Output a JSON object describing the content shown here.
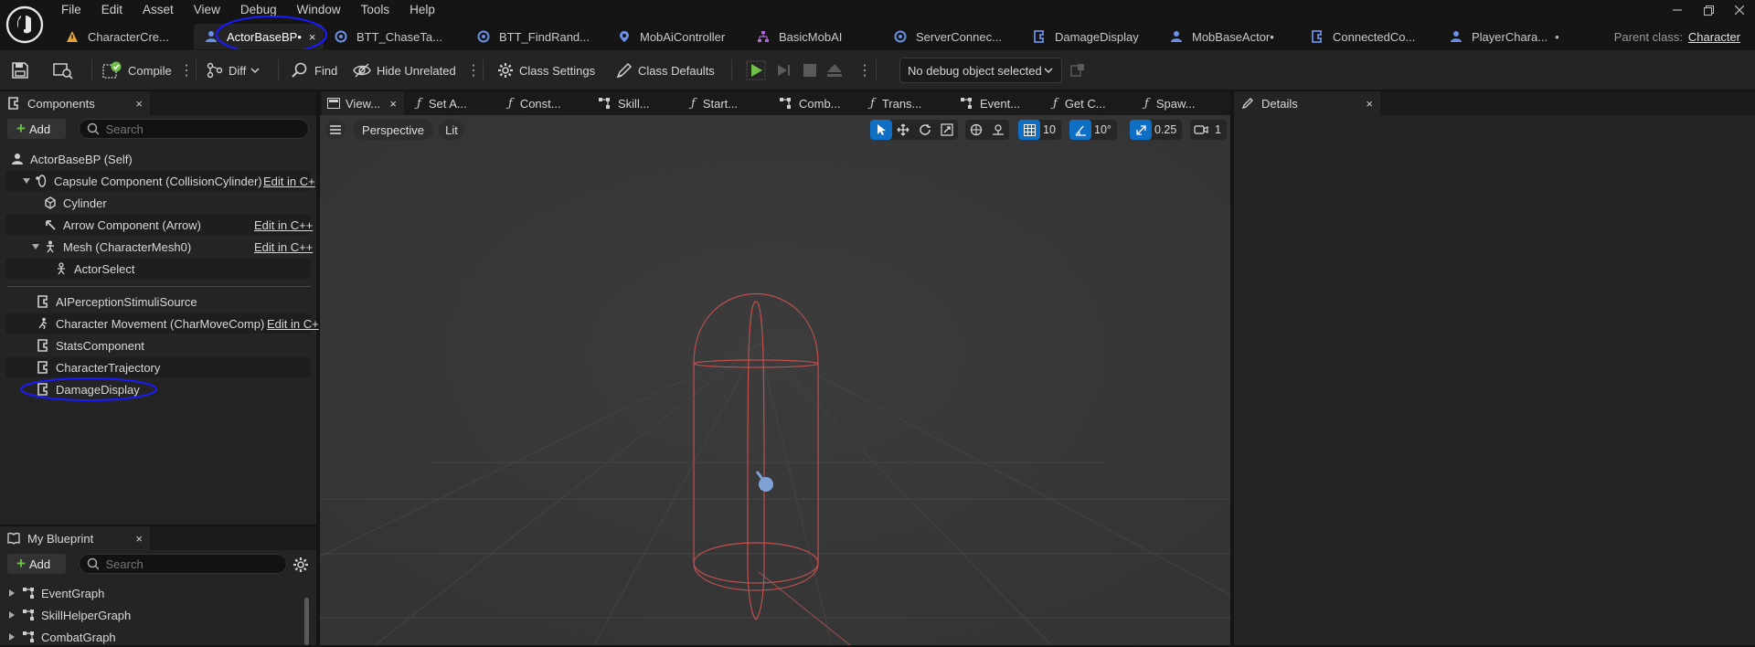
{
  "menu": [
    "File",
    "Edit",
    "Asset",
    "View",
    "Debug",
    "Window",
    "Tools",
    "Help"
  ],
  "doc_tabs": [
    {
      "label": "CharacterCre...",
      "icon": "warning-icon",
      "active": false
    },
    {
      "label": "ActorBaseBP•",
      "icon": "pawn-icon",
      "active": true,
      "close": "×"
    },
    {
      "label": "BTT_ChaseTa...",
      "icon": "task-icon",
      "active": false
    },
    {
      "label": "BTT_FindRand...",
      "icon": "task-icon",
      "active": false
    },
    {
      "label": "MobAiController",
      "icon": "pin-icon",
      "active": false
    },
    {
      "label": "BasicMobAI",
      "icon": "tree-icon",
      "active": false
    },
    {
      "label": "ServerConnec...",
      "icon": "task-icon",
      "active": false
    },
    {
      "label": "DamageDisplay",
      "icon": "component-icon",
      "active": false
    },
    {
      "label": "MobBaseActor•",
      "icon": "pawn-icon",
      "active": false
    },
    {
      "label": "ConnectedCo...",
      "icon": "component-icon",
      "active": false
    },
    {
      "label": "PlayerChara...",
      "icon": "pawn-icon",
      "active": false,
      "mod": "•"
    }
  ],
  "parent_class": {
    "label": "Parent class:",
    "value": "Character"
  },
  "toolbar": {
    "compile": "Compile",
    "diff": "Diff",
    "find": "Find",
    "hide_unrelated": "Hide Unrelated",
    "class_settings": "Class Settings",
    "class_defaults": "Class Defaults",
    "debug_object": "No debug object selected"
  },
  "components": {
    "tab": "Components",
    "close": "×",
    "add": "Add",
    "search_placeholder": "Search",
    "self": "ActorBaseBP (Self)",
    "edit_label": "Edit in C++",
    "edit_label_short": "Edit in C+",
    "items": [
      "Capsule Component (CollisionCylinder)",
      "Cylinder",
      "Arrow Component (Arrow)",
      "Mesh (CharacterMesh0)",
      "ActorSelect",
      "AIPerceptionStimuliSource",
      "Character Movement (CharMoveComp)",
      "StatsComponent",
      "CharacterTrajectory",
      "DamageDisplay"
    ]
  },
  "my_blueprint": {
    "tab": "My Blueprint",
    "close": "×",
    "add": "Add",
    "search_placeholder": "Search",
    "graphs": [
      "EventGraph",
      "SkillHelperGraph",
      "CombatGraph"
    ]
  },
  "graph_tabs": [
    {
      "label": "View...",
      "active": true,
      "close": "×"
    },
    {
      "label": "Set A...",
      "fn": true
    },
    {
      "label": "Const...",
      "fn": true
    },
    {
      "label": "Skill...",
      "fn": false
    },
    {
      "label": "Start...",
      "fn": true
    },
    {
      "label": "Comb...",
      "fn": false
    },
    {
      "label": "Trans...",
      "fn": true
    },
    {
      "label": "Event...",
      "fn": false
    },
    {
      "label": "Get C...",
      "fn": true
    },
    {
      "label": "Spaw...",
      "fn": true
    }
  ],
  "viewport": {
    "perspective": "Perspective",
    "lit": "Lit",
    "grid_snap": "10",
    "rot_snap": "10°",
    "scale_snap": "0.25",
    "camera_speed": "1"
  },
  "details": {
    "tab": "Details",
    "close": "×"
  },
  "colors": {
    "accent": "#0e6fc4",
    "annotation": "#1a1aff",
    "capsule": "#c05050",
    "play": "#6fbf4a"
  }
}
